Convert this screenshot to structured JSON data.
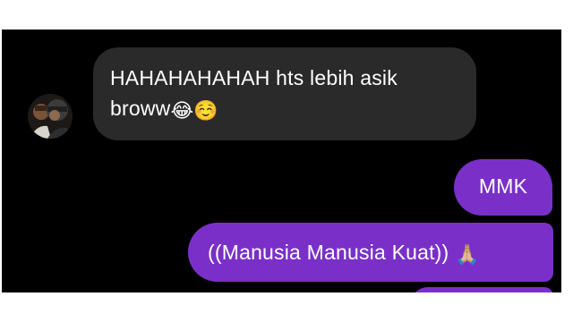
{
  "conversation": {
    "incoming": {
      "line1": "HAHAHAHAHAH hts lebih asik",
      "line2": "broww",
      "emojis": "😂☺️"
    },
    "outgoing": [
      {
        "text": "MMK"
      },
      {
        "text": "((Manusia Manusia Kuat))",
        "emoji": "🙏🏼"
      }
    ]
  },
  "colors": {
    "background": "#000000",
    "incoming_bubble": "#2a2a2a",
    "outgoing_bubble": "#7a30c8",
    "text": "#ffffff"
  },
  "icons": {
    "avatar": "contact-avatar-photo"
  }
}
